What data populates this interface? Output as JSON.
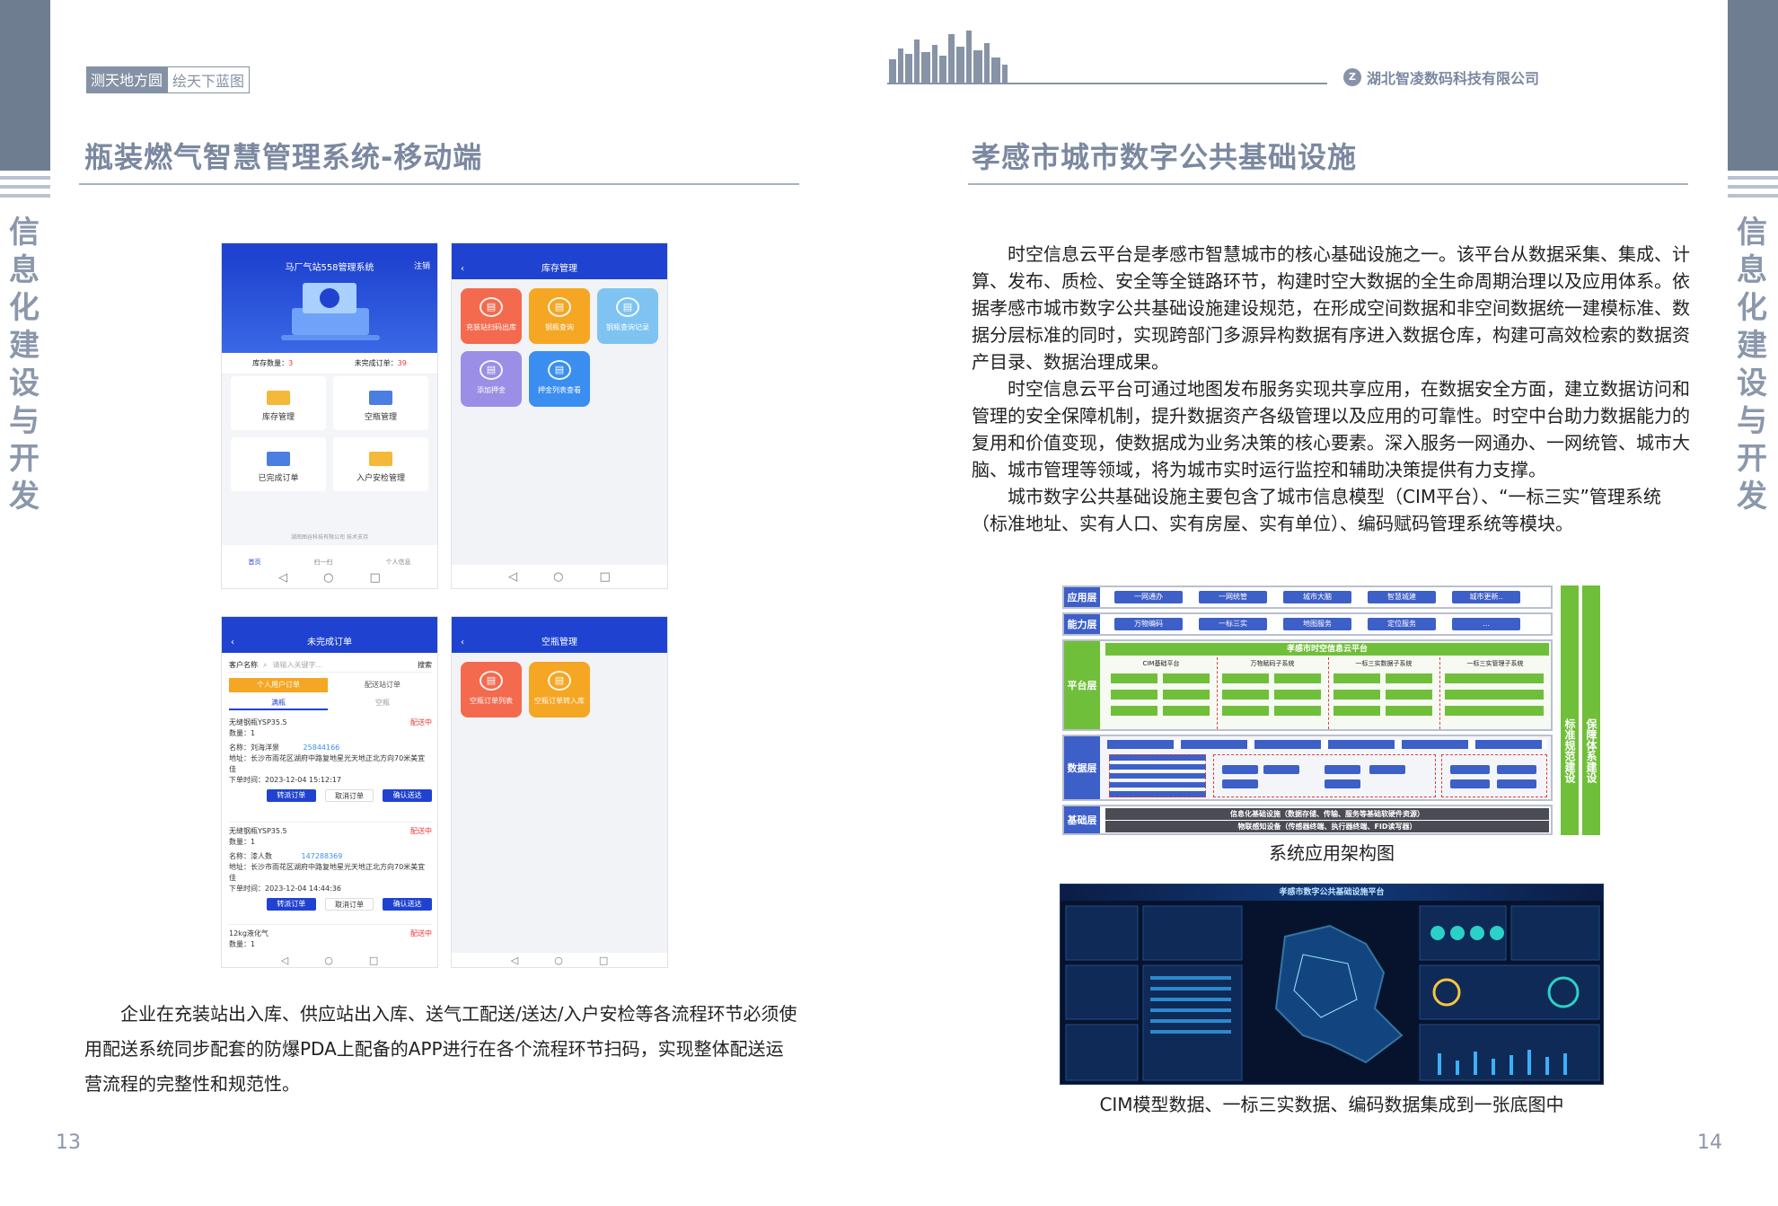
{
  "left_page": {
    "slogan_part1": "测天地方圆",
    "slogan_part2": "绘天下蓝图",
    "title": "瓶装燃气智慧管理系统-移动端",
    "body": "企业在充装站出入库、供应站出入库、送气工配送/送达/入户安检等各流程环节必须使用配送系统同步配套的防爆PDA上配备的APP进行在各个流程环节扫码，实现整体配送运营流程的完整性和规范性。",
    "page_number": "13",
    "side_label": "信息化建设与开发"
  },
  "right_page": {
    "company": "湖北智凌数码科技有限公司",
    "title": "孝感市城市数字公共基础设施",
    "paragraphs": [
      "时空信息云平台是孝感市智慧城市的核心基础设施之一。该平台从数据采集、集成、计算、发布、质检、安全等全链路环节，构建时空大数据的全生命周期治理以及应用体系。依据孝感市城市数字公共基础设施建设规范，在形成空间数据和非空间数据统一建模标准、数据分层标准的同时，实现跨部门多源异构数据有序进入数据仓库，构建可高效检索的数据资产目录、数据治理成果。",
      "时空信息云平台可通过地图发布服务实现共享应用，在数据安全方面，建立数据访问和管理的安全保障机制，提升数据资产各级管理以及应用的可靠性。时空中台助力数据能力的复用和价值变现，使数据成为业务决策的核心要素。深入服务一网通办、一网统管、城市大脑、城市管理等领域，将为城市实时运行监控和辅助决策提供有力支撑。",
      "城市数字公共基础设施主要包含了城市信息模型（CIM平台）、“一标三实”管理系统（标准地址、实有人口、实有房屋、实有单位）、编码赋码管理系统等模块。"
    ],
    "arch_caption": "系统应用架构图",
    "map_caption": "CIM模型数据、一标三实数据、编码数据集成到一张底图中",
    "page_number": "14",
    "side_label": "信息化建设与开发"
  },
  "phones": {
    "p1": {
      "header": "马厂气站558管理系统",
      "logout": "注销",
      "stock_label": "库存数量：",
      "stock_value": "3",
      "pending_label": "未完成订单：",
      "pending_value": "39",
      "cards": [
        "库存管理",
        "空瓶管理",
        "已完成订单",
        "入户安检管理"
      ],
      "footer": "湖南图谷科技有限公司 技术支持",
      "nav": [
        "首页",
        "扫一扫",
        "个人信息"
      ]
    },
    "p2": {
      "header": "库存管理",
      "tiles": [
        "充装站扫码出库",
        "钢瓶查询",
        "钢瓶查询记录",
        "添加押金",
        "押金列表查看"
      ]
    },
    "p3": {
      "header": "未完成订单",
      "search_label": "客户名称",
      "search_placeholder": "请输入关键字...",
      "search_button": "搜索",
      "tab_personal": "个人用户订单",
      "tab_station": "配送站订单",
      "subtab_full": "满瓶",
      "subtab_empty": "空瓶",
      "status": "配送中",
      "orders": [
        {
          "product": "无缝钢瓶YSP35.5",
          "qty": "数量：1",
          "name": "名称：刘海洋景",
          "phone": "25844166",
          "address": "地址：长沙市雨花区湖府中路复地星光天地正北方向70米美宜佳",
          "time": "下单时间：2023-12-04 15:12:17"
        },
        {
          "product": "无缝钢瓶YSP35.5",
          "qty": "数量：1",
          "name": "名称：漆人数",
          "phone": "147288369",
          "address": "地址：长沙市雨花区湖府中路复地星光天地正北方向70米美宜佳",
          "time": "下单时间：2023-12-04 14:44:36"
        },
        {
          "product": "12kg液化气",
          "qty": "数量：1"
        }
      ],
      "btn_transfer": "转派订单",
      "btn_cancel": "取消订单",
      "btn_confirm": "确认送达"
    },
    "p4": {
      "header": "空瓶管理",
      "tiles": [
        "空瓶订单列表",
        "空瓶订单转入库"
      ]
    }
  },
  "architecture": {
    "layers": [
      "应用层",
      "能力层",
      "平台层",
      "数据层",
      "基础层"
    ],
    "app_items": [
      "一网通办",
      "一网统管",
      "城市大脑",
      "智慧城建",
      "城市更新.."
    ],
    "capability_items": [
      "万物编码",
      "一标三实",
      "地图服务",
      "定位服务",
      "..."
    ],
    "platform_title": "孝感市时空信息云平台",
    "subsystems": [
      "CIM基础平台",
      "万物赋码子系统",
      "一标三实数据子系统",
      "一标三实管理子系统"
    ],
    "base_lines": [
      "信息化基础设施（数据存储、传输、服务等基础软硬件资源）",
      "物联感知设备（传感器终端、执行器终端、FID读写器）"
    ],
    "side_standard": "标准规范建设",
    "side_security": "保障体系建设"
  },
  "dashboard": {
    "title": "孝感市数字公共基础设施平台"
  }
}
